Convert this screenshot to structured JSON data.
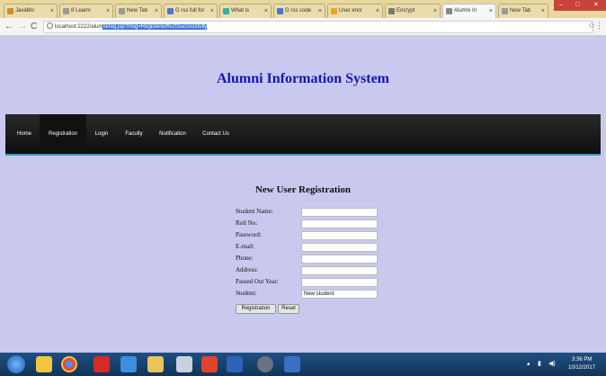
{
  "tabs": [
    {
      "label": "JavaMo",
      "color": "#d08b2a"
    },
    {
      "label": "8 Learni",
      "color": "#999999"
    },
    {
      "label": "New Tab",
      "color": "#999999"
    },
    {
      "label": "G rss full for",
      "color": "#4a78d0"
    },
    {
      "label": "What is",
      "color": "#2bb3a8"
    },
    {
      "label": "G rss code",
      "color": "#4a78d0"
    },
    {
      "label": "User encr",
      "color": "#e8a625"
    },
    {
      "label": "Encrypt",
      "color": "#7a7a7a"
    },
    {
      "label": "Alumni In",
      "color": "#888888"
    },
    {
      "label": "New Tab",
      "color": "#999999"
    }
  ],
  "address": {
    "host": "localhost:2222/alum",
    "selected": "ni/reg.jsp?msg=Registered%20successfully"
  },
  "site_title": "Alumni Information System",
  "menu": [
    "Home",
    "Registration",
    "Login",
    "Faculty",
    "Notification",
    "Contact Us"
  ],
  "form": {
    "title": "New User Registration",
    "fields": [
      {
        "label": "Student Name:",
        "value": ""
      },
      {
        "label": "Roll No:",
        "value": ""
      },
      {
        "label": "Password:",
        "value": ""
      },
      {
        "label": "E-mail:",
        "value": ""
      },
      {
        "label": "Phone:",
        "value": ""
      },
      {
        "label": "Address:",
        "value": ""
      },
      {
        "label": "Passed Out Year:",
        "value": ""
      },
      {
        "label": "Student:",
        "value": "New student"
      }
    ],
    "buttons": [
      "Registration",
      "Reset"
    ]
  },
  "taskbar": {
    "icons": [
      "start-orb-icon",
      "folder-icon",
      "chrome-icon",
      "pdf-icon",
      "ie-icon",
      "explorer-icon",
      "paint-icon",
      "office-icon",
      "word-icon",
      "settings-icon",
      "media-icon"
    ],
    "time": "3:36 PM",
    "date": "10/12/2017"
  },
  "colors": {
    "title": "#1515c4",
    "page_bg": "#c9c8ee",
    "menu_bg": "#1a1a1a",
    "menu_accent": "#32a0b4"
  }
}
